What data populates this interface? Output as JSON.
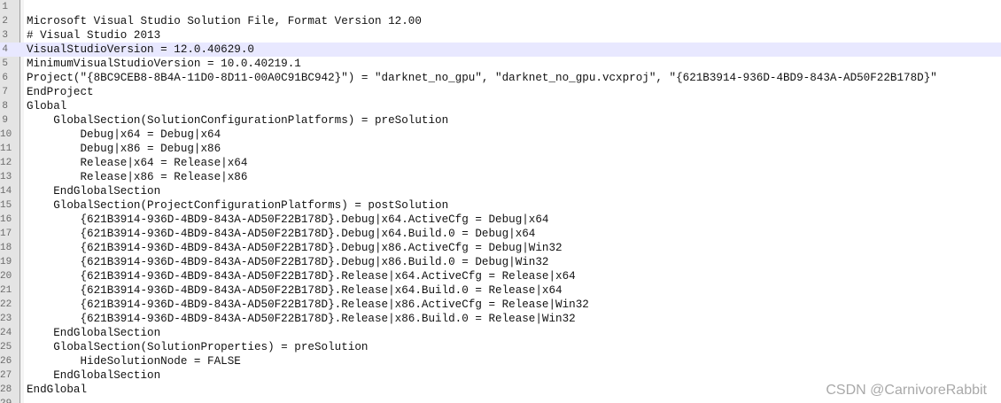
{
  "editor": {
    "current_line": 4,
    "lines": [
      {
        "number": "1",
        "text": ""
      },
      {
        "number": "2",
        "text": "Microsoft Visual Studio Solution File, Format Version 12.00"
      },
      {
        "number": "3",
        "text": "# Visual Studio 2013"
      },
      {
        "number": "4",
        "text": "VisualStudioVersion = 12.0.40629.0"
      },
      {
        "number": "5",
        "text": "MinimumVisualStudioVersion = 10.0.40219.1"
      },
      {
        "number": "6",
        "text": "Project(\"{8BC9CEB8-8B4A-11D0-8D11-00A0C91BC942}\") = \"darknet_no_gpu\", \"darknet_no_gpu.vcxproj\", \"{621B3914-936D-4BD9-843A-AD50F22B178D}\""
      },
      {
        "number": "7",
        "text": "EndProject"
      },
      {
        "number": "8",
        "text": "Global"
      },
      {
        "number": "9",
        "text": "    GlobalSection(SolutionConfigurationPlatforms) = preSolution"
      },
      {
        "number": "10",
        "text": "        Debug|x64 = Debug|x64"
      },
      {
        "number": "11",
        "text": "        Debug|x86 = Debug|x86"
      },
      {
        "number": "12",
        "text": "        Release|x64 = Release|x64"
      },
      {
        "number": "13",
        "text": "        Release|x86 = Release|x86"
      },
      {
        "number": "14",
        "text": "    EndGlobalSection"
      },
      {
        "number": "15",
        "text": "    GlobalSection(ProjectConfigurationPlatforms) = postSolution"
      },
      {
        "number": "16",
        "text": "        {621B3914-936D-4BD9-843A-AD50F22B178D}.Debug|x64.ActiveCfg = Debug|x64"
      },
      {
        "number": "17",
        "text": "        {621B3914-936D-4BD9-843A-AD50F22B178D}.Debug|x64.Build.0 = Debug|x64"
      },
      {
        "number": "18",
        "text": "        {621B3914-936D-4BD9-843A-AD50F22B178D}.Debug|x86.ActiveCfg = Debug|Win32"
      },
      {
        "number": "19",
        "text": "        {621B3914-936D-4BD9-843A-AD50F22B178D}.Debug|x86.Build.0 = Debug|Win32"
      },
      {
        "number": "20",
        "text": "        {621B3914-936D-4BD9-843A-AD50F22B178D}.Release|x64.ActiveCfg = Release|x64"
      },
      {
        "number": "21",
        "text": "        {621B3914-936D-4BD9-843A-AD50F22B178D}.Release|x64.Build.0 = Release|x64"
      },
      {
        "number": "22",
        "text": "        {621B3914-936D-4BD9-843A-AD50F22B178D}.Release|x86.ActiveCfg = Release|Win32"
      },
      {
        "number": "23",
        "text": "        {621B3914-936D-4BD9-843A-AD50F22B178D}.Release|x86.Build.0 = Release|Win32"
      },
      {
        "number": "24",
        "text": "    EndGlobalSection"
      },
      {
        "number": "25",
        "text": "    GlobalSection(SolutionProperties) = preSolution"
      },
      {
        "number": "26",
        "text": "        HideSolutionNode = FALSE"
      },
      {
        "number": "27",
        "text": "    EndGlobalSection"
      },
      {
        "number": "28",
        "text": "EndGlobal"
      },
      {
        "number": "29",
        "text": ""
      }
    ]
  },
  "watermark": "CSDN @CarnivoreRabbit",
  "colors": {
    "background": "#ffffff",
    "gutter": "#e4e4e4",
    "current_line_highlight": "#e8e8ff",
    "text": "#111111",
    "line_number": "#6a6a6a",
    "watermark": "#a9a9a9"
  }
}
